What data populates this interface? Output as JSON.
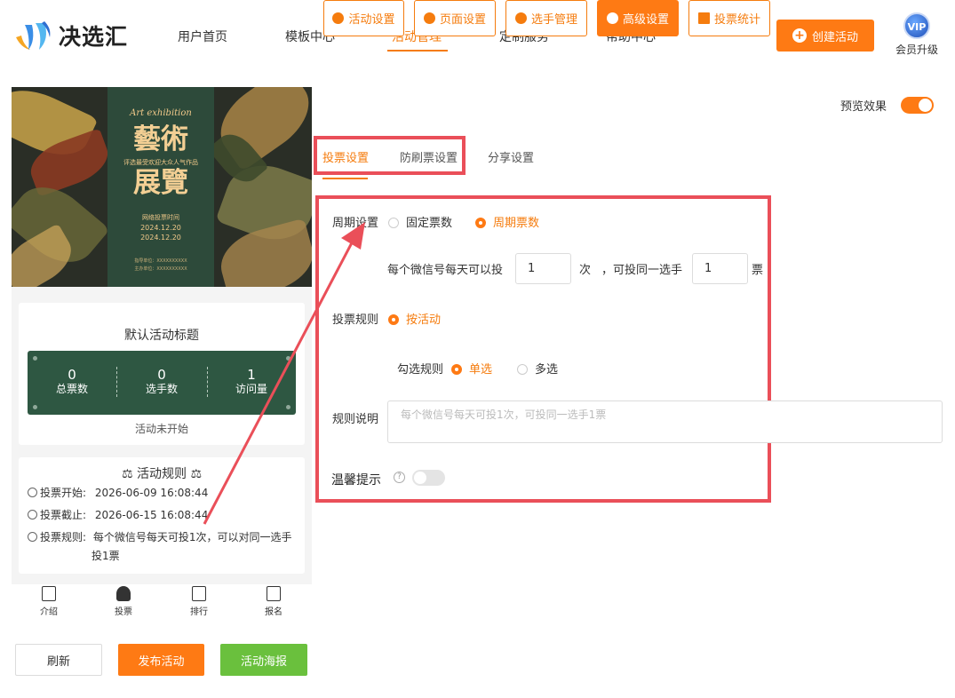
{
  "header": {
    "logo_text": "决选汇",
    "nav": [
      {
        "label": "用户首页"
      },
      {
        "label": "模板中心"
      },
      {
        "label": "活动管理",
        "active": true
      },
      {
        "label": "定制服务"
      },
      {
        "label": "帮助中心"
      }
    ],
    "create_label": "创建活动",
    "vip_badge": "VIP",
    "vip_label": "会员升级"
  },
  "preview": {
    "poster": {
      "script": "Art exhibition",
      "big1": "藝術",
      "big2": "展覽",
      "sub": "评选最受欢迎大众人气作品",
      "line": "网络投票时间",
      "date1": "2024.12.20",
      "date2": "2024.12.20",
      "foot1": "指导单位：XXXXXXXXXX",
      "foot2": "主办单位：XXXXXXXXXX"
    },
    "title": "默认活动标题",
    "stats": [
      {
        "value": "0",
        "label": "总票数"
      },
      {
        "value": "0",
        "label": "选手数"
      },
      {
        "value": "1",
        "label": "访问量"
      }
    ],
    "status": "活动未开始",
    "rules_title": "活动规则",
    "rules": {
      "start_label": "投票开始:",
      "start_value": "2026-06-09 16:08:44",
      "end_label": "投票截止:",
      "end_value": "2026-06-15 16:08:44",
      "rule_label": "投票规则:",
      "rule_value_1": "每个微信号每天可投1次，可以对同一选手",
      "rule_value_2": "投1票"
    },
    "tabbar": [
      "介绍",
      "投票",
      "排行",
      "报名"
    ]
  },
  "actions": {
    "refresh": "刷新",
    "publish": "发布活动",
    "poster": "活动海报"
  },
  "settings_tabs": [
    {
      "label": "活动设置"
    },
    {
      "label": "页面设置"
    },
    {
      "label": "选手管理"
    },
    {
      "label": "高级设置",
      "active": true
    },
    {
      "label": "投票统计"
    }
  ],
  "preview_toggle_label": "预览效果",
  "sub_tabs": [
    {
      "label": "投票设置",
      "active": true
    },
    {
      "label": "防刷票设置"
    },
    {
      "label": "分享设置"
    }
  ],
  "form": {
    "period_label": "周期设置",
    "period_options": [
      "固定票数",
      "周期票数"
    ],
    "per_day_text": "每个微信号每天可以投",
    "per_day_value": "1",
    "unit_times": "次",
    "same_player_text": "，可投同一选手",
    "same_player_value": "1",
    "unit_votes": "票",
    "rule_label": "投票规则",
    "rule_option": "按活动",
    "check_label": "勾选规则",
    "check_options": [
      "单选",
      "多选"
    ],
    "desc_label": "规则说明",
    "desc_placeholder": "每个微信号每天可投1次，可投同一选手1票",
    "tips_label": "温馨提示",
    "tips_help": "?"
  },
  "colors": {
    "accent": "#fe7a14",
    "highlight": "#ea4f59",
    "stats_bg": "#2e5742",
    "publish": "#fe7a14",
    "poster_btn": "#6ac03d"
  }
}
